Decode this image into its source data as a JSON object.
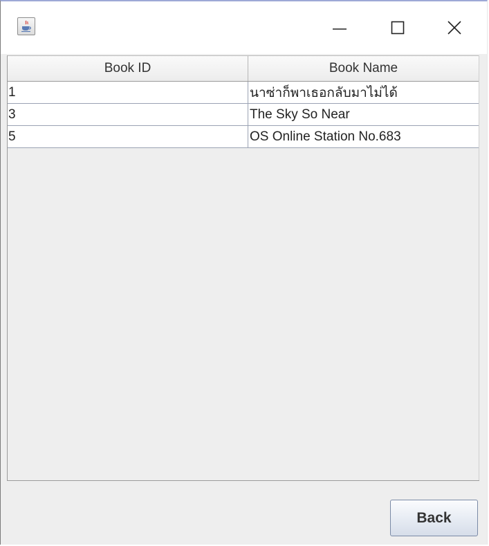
{
  "window": {
    "title": "",
    "icon": "java-coffee-icon",
    "controls": {
      "minimize_icon": "minimize-icon",
      "maximize_icon": "maximize-icon",
      "close_icon": "close-icon"
    }
  },
  "table": {
    "columns": [
      "Book ID",
      "Book Name"
    ],
    "rows": [
      {
        "id": "1",
        "name": "นาซ่าก็พาเธอกลับมาไม่ได้"
      },
      {
        "id": "3",
        "name": "The Sky So Near"
      },
      {
        "id": "5",
        "name": "OS Online Station No.683"
      }
    ]
  },
  "footer": {
    "back_label": "Back"
  },
  "colors": {
    "background": "#eeeeee",
    "table_row": "#ffffff",
    "grid_line": "#9aa2b3",
    "title_border": "#9da8d6"
  }
}
